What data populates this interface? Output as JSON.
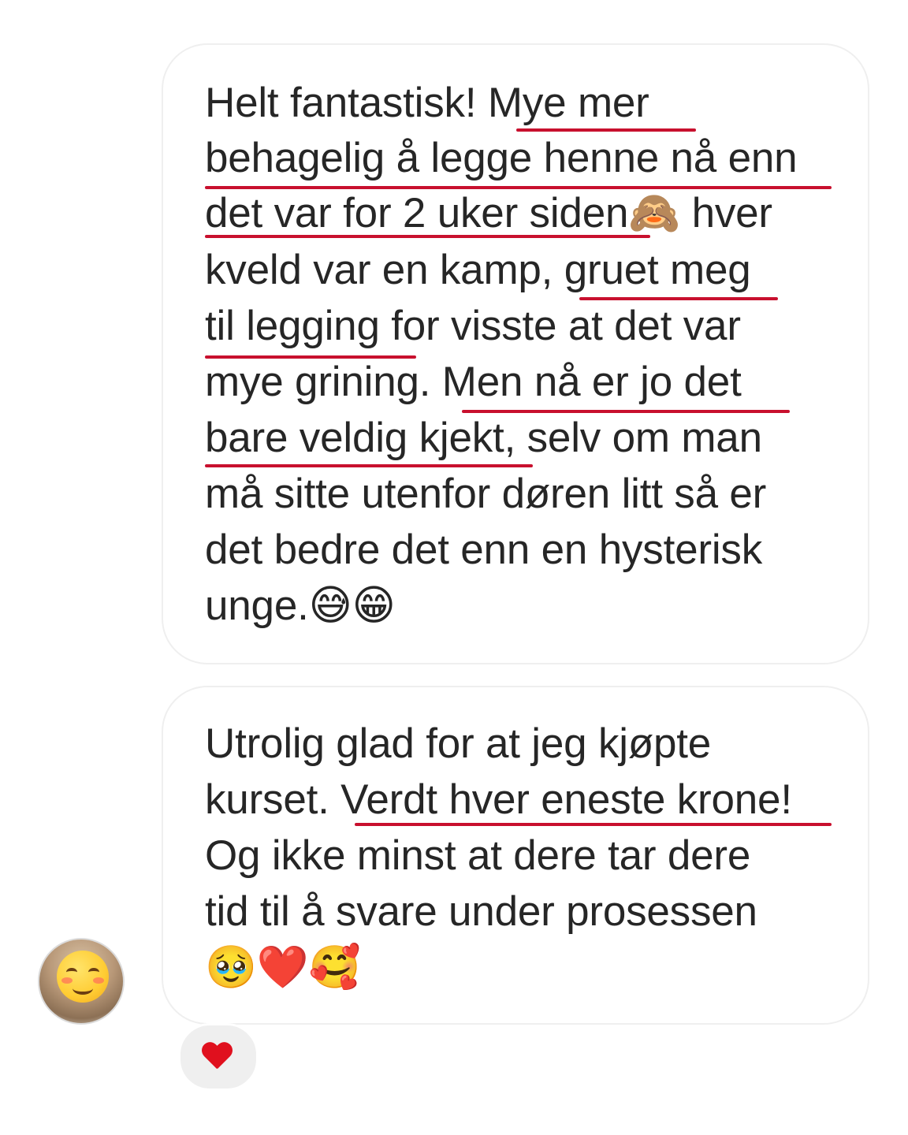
{
  "messages": [
    {
      "lines": [
        "Helt fantastisk! Mye mer",
        "behagelig å legge henne nå enn",
        "det var for 2 uker siden🙈 hver",
        "kveld var en kamp, gruet meg",
        "til legging for visste at det var",
        "mye grining. Men nå er jo det",
        "bare veldig kjekt, selv om man",
        "må sitte utenfor døren litt så er",
        "det bedre det enn en hysterisk",
        "unge.😅😁"
      ]
    },
    {
      "lines": [
        "Utrolig glad for at jeg kjøpte",
        "kurset. Verdt hver eneste krone!",
        "Og ikke minst at dere tar dere",
        "tid til å svare under prosessen",
        "🥹❤️🥰"
      ]
    }
  ],
  "highlight_color": "#c8102e",
  "avatar": {
    "icon": "blushing-smiley-sticker"
  },
  "reaction": {
    "icon": "red-heart-icon",
    "color": "#e0101e"
  }
}
